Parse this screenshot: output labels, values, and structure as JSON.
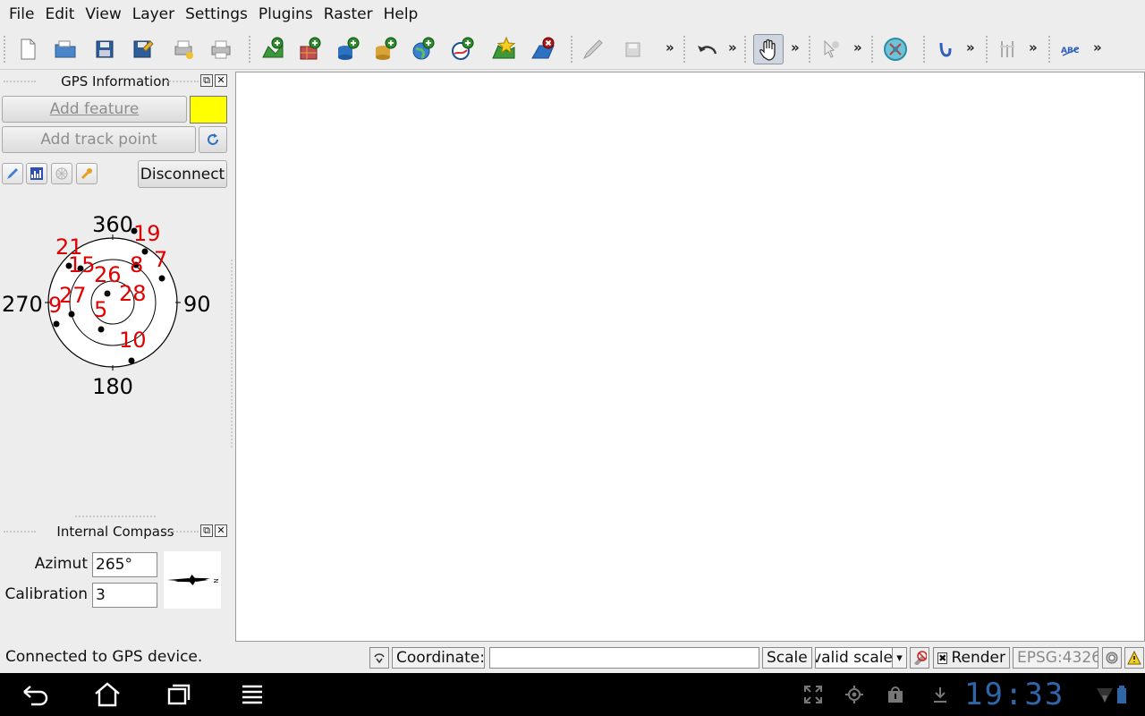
{
  "menubar": {
    "items": [
      "File",
      "Edit",
      "View",
      "Layer",
      "Settings",
      "Plugins",
      "Raster",
      "Help"
    ]
  },
  "toolbar": {
    "overflow_label": "»"
  },
  "gps_panel": {
    "title": "GPS Information",
    "add_feature_label": "Add feature",
    "add_track_point_label": "Add track point",
    "disconnect_label": "Disconnect",
    "feature_color": "#ffff00",
    "skyplot": {
      "north_label": "360",
      "east_label": "90",
      "south_label": "180",
      "west_label": "270",
      "satellites": [
        "19",
        "21",
        "7",
        "15",
        "8",
        "26",
        "28",
        "27",
        "9",
        "5",
        "10"
      ]
    }
  },
  "compass_panel": {
    "title": "Internal Compass",
    "azimut_label": "Azimut",
    "azimut_value": "265°",
    "calibration_label": "Calibration",
    "calibration_value": "3",
    "rose_label": "N"
  },
  "statusbar": {
    "message": "Connected to GPS device.",
    "coordinate_label": "Coordinate:",
    "coordinate_value": "",
    "scale_label": "Scale",
    "scale_value": "valid scale",
    "render_label": "Render",
    "render_checked": true,
    "crs_label": "EPSG:4326"
  },
  "system_bar": {
    "clock": "19:33"
  },
  "colors": {
    "accent_clock": "#2f66a8",
    "satellite_label": "#e00000"
  }
}
